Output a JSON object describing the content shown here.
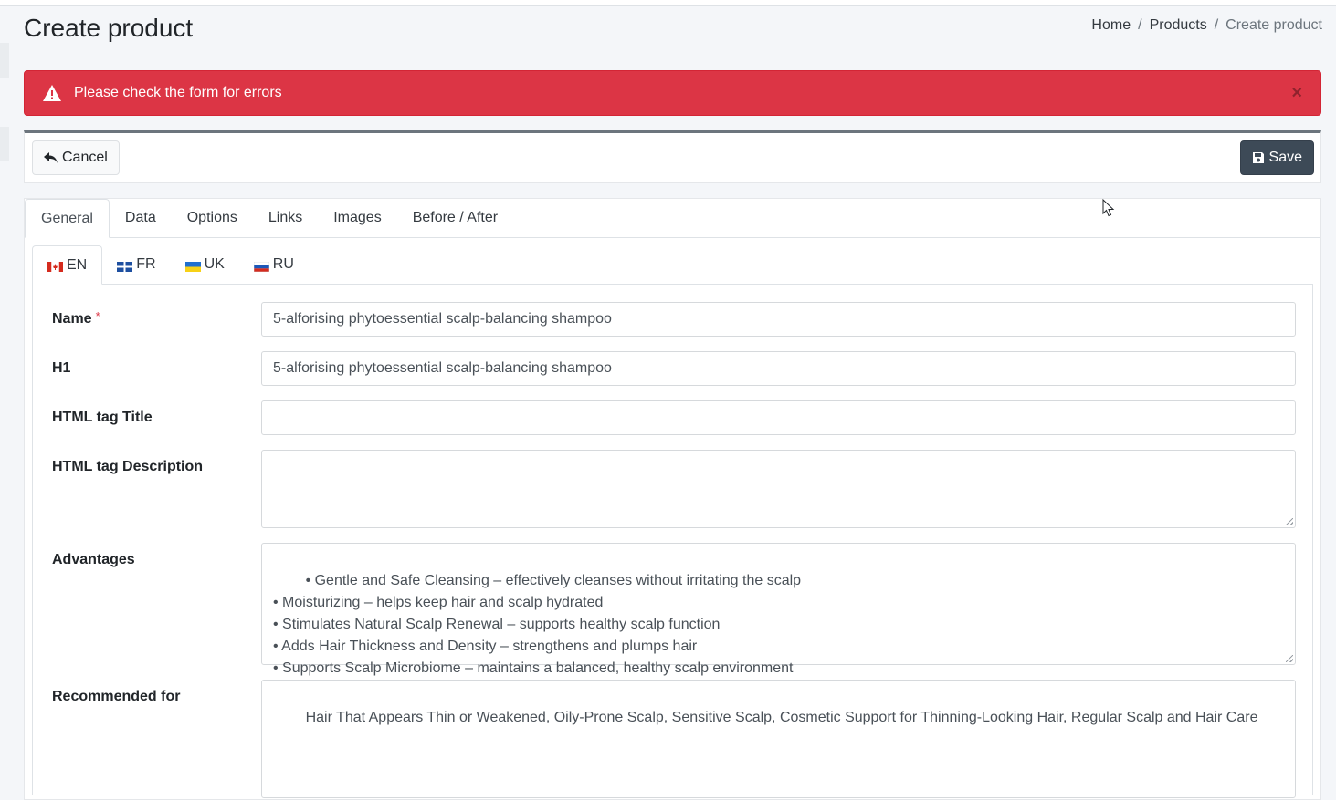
{
  "page": {
    "title": "Create product"
  },
  "breadcrumb": {
    "items": [
      "Home",
      "Products",
      "Create product"
    ],
    "separator": "/"
  },
  "alert": {
    "message": "Please check the form for errors",
    "close": "×",
    "icon": "warning-triangle-icon",
    "color": "#dc3545"
  },
  "toolbar": {
    "cancel_label": "Cancel",
    "cancel_icon": "reply-arrow-icon",
    "save_label": "Save",
    "save_icon": "floppy-disk-icon",
    "save_color": "#3d4a57"
  },
  "tabs": [
    {
      "label": "General",
      "active": true
    },
    {
      "label": "Data",
      "active": false
    },
    {
      "label": "Options",
      "active": false
    },
    {
      "label": "Links",
      "active": false
    },
    {
      "label": "Images",
      "active": false
    },
    {
      "label": "Before / After",
      "active": false
    }
  ],
  "languages": [
    {
      "code": "EN",
      "flag": "canada-flag-icon",
      "active": true
    },
    {
      "code": "FR",
      "flag": "quebec-flag-icon",
      "active": false
    },
    {
      "code": "UK",
      "flag": "ukraine-flag-icon",
      "active": false
    },
    {
      "code": "RU",
      "flag": "russia-flag-icon",
      "active": false
    }
  ],
  "form": {
    "name": {
      "label": "Name",
      "required_mark": "*",
      "value": "5-alforising phytoessential scalp-balancing shampoo"
    },
    "h1": {
      "label": "H1",
      "value": "5-alforising phytoessential scalp-balancing shampoo"
    },
    "html_title": {
      "label": "HTML tag Title",
      "value": ""
    },
    "html_description": {
      "label": "HTML tag Description",
      "value": ""
    },
    "advantages": {
      "label": "Advantages",
      "value": "• Gentle and Safe Cleansing – effectively cleanses without irritating the scalp\n• Moisturizing – helps keep hair and scalp hydrated\n• Stimulates Natural Scalp Renewal – supports healthy scalp function\n• Adds Hair Thickness and Density – strengthens and plumps hair\n• Supports Scalp Microbiome – maintains a balanced, healthy scalp environment"
    },
    "recommended_for": {
      "label": "Recommended for",
      "value": "Hair That Appears Thin or Weakened, Oily-Prone Scalp, Sensitive Scalp, Cosmetic Support for Thinning-Looking Hair, Regular Scalp and Hair Care"
    }
  }
}
